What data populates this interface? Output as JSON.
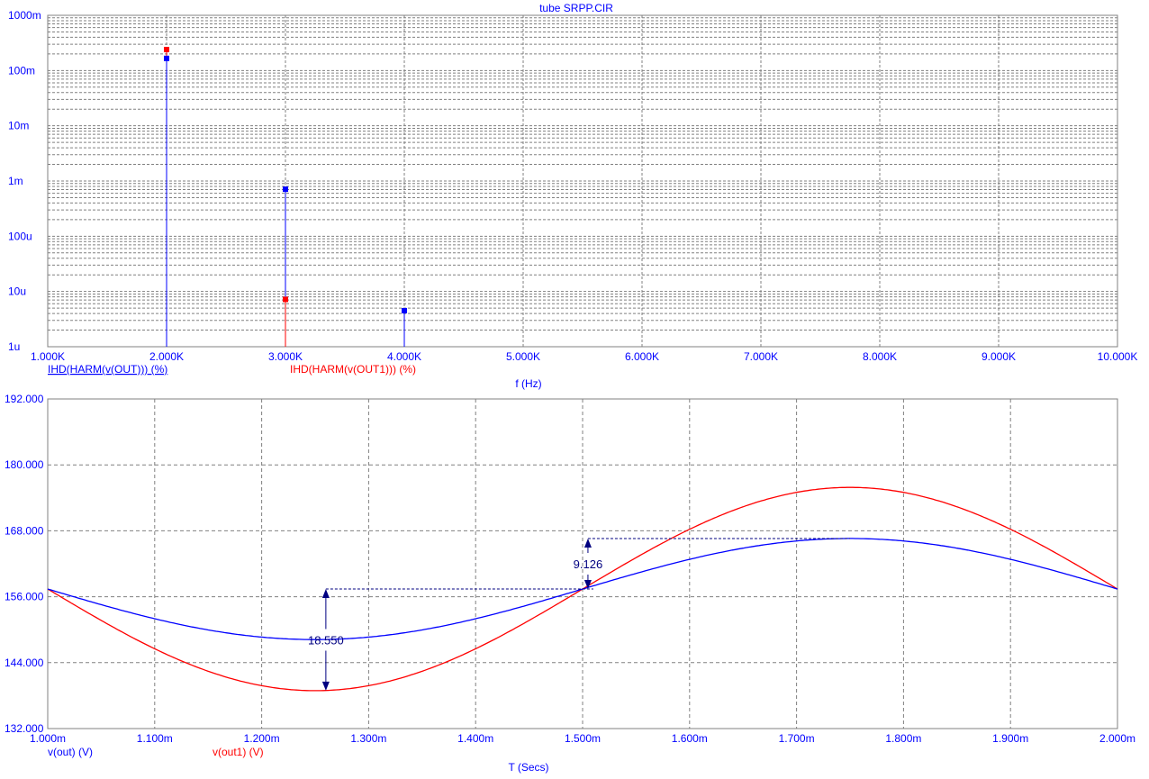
{
  "title": "tube SRPP.CIR",
  "colors": {
    "blue": "#0000ff",
    "red": "#ff0000",
    "annotation": "#000080",
    "grid": "#808080",
    "axis": "#808080"
  },
  "chart_data": [
    {
      "type": "bar",
      "subtype": "stem-log",
      "xlabel": "f (Hz)",
      "xlim": [
        1000,
        10000
      ],
      "xticks": [
        1000,
        2000,
        3000,
        4000,
        5000,
        6000,
        7000,
        8000,
        9000,
        10000
      ],
      "xtick_labels": [
        "1.000K",
        "2.000K",
        "3.000K",
        "4.000K",
        "5.000K",
        "6.000K",
        "7.000K",
        "8.000K",
        "9.000K",
        "10.000K"
      ],
      "ylim": [
        1e-06,
        1
      ],
      "yscale": "log",
      "ytick_labels": [
        "1000m",
        "100m",
        "10m",
        "1m",
        "100u",
        "10u",
        "1u"
      ],
      "grid": true,
      "series": [
        {
          "name": "IHD(HARM(v(OUT))) (%)",
          "color": "blue",
          "x": [
            2000,
            3000,
            4000
          ],
          "values": [
            0.166,
            0.00071,
            4.5e-06
          ]
        },
        {
          "name": "IHD(HARM(v(OUT1))) (%)",
          "color": "red",
          "x": [
            2000,
            3000
          ],
          "values": [
            0.24,
            7.2e-06
          ]
        }
      ]
    },
    {
      "type": "line",
      "xlabel": "T (Secs)",
      "xlim": [
        0.001,
        0.002
      ],
      "xtick_labels": [
        "1.000m",
        "1.100m",
        "1.200m",
        "1.300m",
        "1.400m",
        "1.500m",
        "1.600m",
        "1.700m",
        "1.800m",
        "1.900m",
        "2.000m"
      ],
      "ylim": [
        132,
        192
      ],
      "ytick_labels": [
        "192.000",
        "180.000",
        "168.000",
        "156.000",
        "144.000",
        "132.000"
      ],
      "grid": true,
      "series": [
        {
          "name": "v(out) (V)",
          "color": "blue",
          "offset": 157.4,
          "amplitude": 9.2,
          "period": 0.001,
          "phase_min_at": 0.00125
        },
        {
          "name": "v(out1) (V)",
          "color": "red",
          "offset": 157.4,
          "amplitude": 18.5,
          "period": 0.001,
          "phase_min_at": 0.00125
        }
      ],
      "annotations": [
        {
          "label": "18.550",
          "x": 0.00126,
          "y_from": 138.9,
          "y_to": 157.4,
          "ref_line_to_x": 0.00151
        },
        {
          "label": "9.126",
          "x": 0.001505,
          "y_from": 157.4,
          "y_to": 166.6,
          "ref_line_to_x": 0.00175
        }
      ]
    }
  ]
}
